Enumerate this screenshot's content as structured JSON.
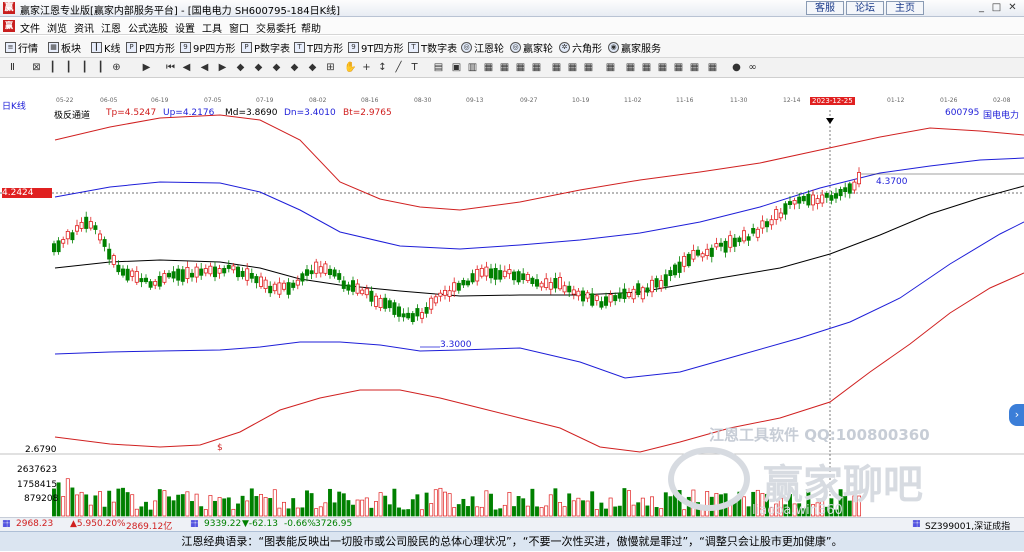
{
  "window": {
    "title": "赢家江恩专业版[赢家内部服务平台] - [国电电力  SH600795-184日K线]",
    "buttons": [
      "客服",
      "论坛",
      "主页"
    ],
    "controls": [
      "_",
      "□",
      "✕"
    ]
  },
  "menu": [
    "文件",
    "浏览",
    "资讯",
    "江恩",
    "公式选股",
    "设置",
    "工具",
    "窗口",
    "交易委托",
    "帮助"
  ],
  "toolbar1": [
    {
      "icon": "list-icon",
      "label": "行情"
    },
    {
      "icon": "grid-icon",
      "label": "板块"
    },
    {
      "icon": "candle-icon",
      "label": "K线"
    },
    {
      "icon": "p-icon",
      "label": "P四方形"
    },
    {
      "icon": "9p-icon",
      "label": "9P四方形"
    },
    {
      "icon": "table-p-icon",
      "label": "P数字表"
    },
    {
      "icon": "t-icon",
      "label": "T四方形"
    },
    {
      "icon": "9t-icon",
      "label": "9T四方形"
    },
    {
      "icon": "table-t-icon",
      "label": "T数字表"
    },
    {
      "icon": "wheel-icon",
      "label": "江恩轮"
    },
    {
      "icon": "wheel2-icon",
      "label": "赢家轮"
    },
    {
      "icon": "hexagon-icon",
      "label": "六角形"
    },
    {
      "icon": "service-icon",
      "label": "赢家服务"
    }
  ],
  "dates": [
    "05-22",
    "06-05",
    "06-19",
    "07-05",
    "07-19",
    "08-02",
    "08-16",
    "08-30",
    "09-13",
    "09-27",
    "10-19",
    "11-02",
    "11-16",
    "11-30",
    "12-14",
    "2023-12-25",
    "01-12",
    "01-26",
    "02-08"
  ],
  "chart_info": {
    "period": "日K线",
    "indicator": "极反通道",
    "tp": "Tp=4.5247",
    "up": "Up=4.2176",
    "md": "Md=3.8690",
    "dn": "Dn=3.4010",
    "bt": "Bt=2.9765",
    "stock": "600795",
    "stock_name": "国电电力",
    "price_tag": "4.2424",
    "high_label": "4.3700",
    "low_label": "3.3000",
    "bottom_price": "2.6790",
    "dollar_mark": "$",
    "vol_ticks": [
      "2637623",
      "1758415",
      "879208"
    ]
  },
  "watermark": {
    "line1": "江恩工具软件  QQ:100800360",
    "line2": "赢家聊吧",
    "line3": "liaoba.win360"
  },
  "colors": {
    "up": "#e02020",
    "down": "#008000",
    "mid": "#000000",
    "blue": "#1e1ed8",
    "red_band": "#d02020"
  },
  "status": {
    "sh_index": "2968.23",
    "sh_change": "▲5.95",
    "sh_pct": "0.20%",
    "sh_vol": "2869.12亿",
    "sz_index": "9339.22",
    "sz_change": "▼-62.13",
    "sz_pct": "-0.66%",
    "sz_vol": "3726.95",
    "right": "SZ399001,深证成指"
  },
  "quote": "江恩经典语录：“图表能反映出一切股市或公司股民的总体心理状况”，“不要一次性买进，傲慢就是罪过”，“调整只会让股市更加健康”。"
}
